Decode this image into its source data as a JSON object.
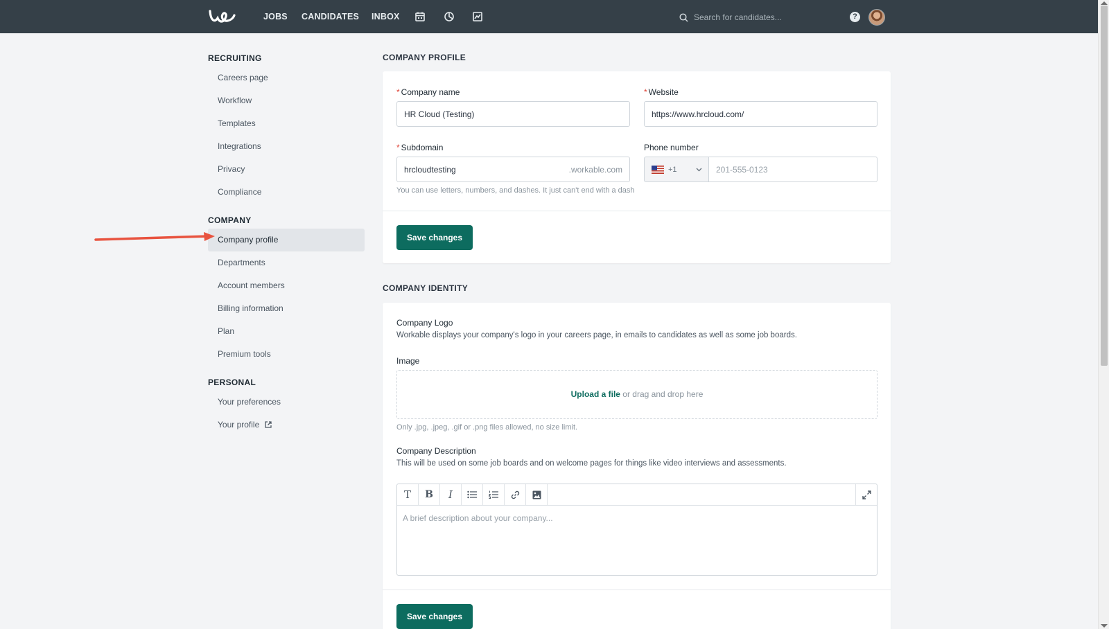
{
  "nav": {
    "jobs": "JOBS",
    "candidates": "CANDIDATES",
    "inbox": "INBOX",
    "search_placeholder": "Search for candidates..."
  },
  "sidebar": {
    "recruiting": {
      "heading": "RECRUITING",
      "items": [
        "Careers page",
        "Workflow",
        "Templates",
        "Integrations",
        "Privacy",
        "Compliance"
      ]
    },
    "company": {
      "heading": "COMPANY",
      "items": [
        "Company profile",
        "Departments",
        "Account members",
        "Billing information",
        "Plan",
        "Premium tools"
      ]
    },
    "personal": {
      "heading": "PERSONAL",
      "items": [
        "Your preferences",
        "Your profile"
      ]
    }
  },
  "company_profile": {
    "title": "COMPANY PROFILE",
    "company_name_label": "Company name",
    "company_name_value": "HR Cloud (Testing)",
    "website_label": "Website",
    "website_value": "https://www.hrcloud.com/",
    "subdomain_label": "Subdomain",
    "subdomain_value": "hrcloudtesting",
    "subdomain_suffix": ".workable.com",
    "subdomain_hint": "You can use letters, numbers, and dashes. It just can't end with a dash",
    "phone_label": "Phone number",
    "phone_code": "+1",
    "phone_placeholder": "201-555-0123",
    "save": "Save changes"
  },
  "company_identity": {
    "title": "COMPANY IDENTITY",
    "logo_label": "Company Logo",
    "logo_desc": "Workable displays your company's logo in your careers page, in emails to candidates as well as some job boards.",
    "image_label": "Image",
    "upload_link": "Upload a file",
    "upload_rest": " or drag and drop here",
    "image_hint": "Only .jpg, .jpeg, .gif or .png files allowed, no size limit.",
    "desc_label": "Company Description",
    "desc_text": "This will be used on some job boards and on welcome pages for things like video interviews and assessments.",
    "desc_placeholder": "A brief description about your company...",
    "save": "Save changes"
  },
  "colors": {
    "topbar": "#354048",
    "accent": "#0d6c5f",
    "annotation_arrow": "#e8533f"
  }
}
